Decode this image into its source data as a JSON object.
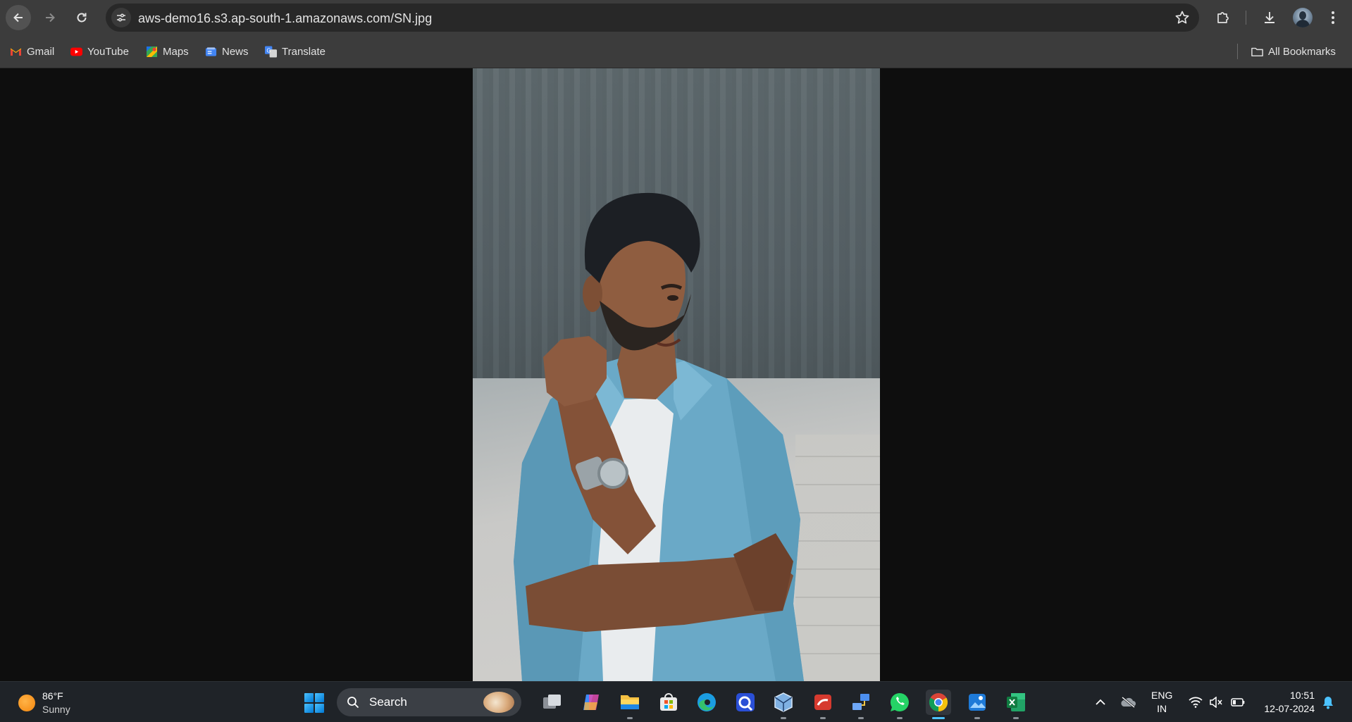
{
  "browser": {
    "url": "aws-demo16.s3.ap-south-1.amazonaws.com/SN.jpg",
    "bookmarks": [
      {
        "label": "Gmail",
        "icon": "gmail-icon"
      },
      {
        "label": "YouTube",
        "icon": "youtube-icon"
      },
      {
        "label": "Maps",
        "icon": "maps-icon"
      },
      {
        "label": "News",
        "icon": "news-icon"
      },
      {
        "label": "Translate",
        "icon": "translate-icon"
      }
    ],
    "all_bookmarks_label": "All Bookmarks"
  },
  "taskbar": {
    "weather": {
      "temp": "86°F",
      "condition": "Sunny"
    },
    "search_label": "Search",
    "apps": [
      "task-view",
      "copilot",
      "file-explorer",
      "microsoft-store",
      "edge",
      "app-c",
      "virtualbox",
      "app-red",
      "network-app",
      "whatsapp",
      "chrome",
      "photos",
      "excel"
    ],
    "language": {
      "line1": "ENG",
      "line2": "IN"
    },
    "clock": {
      "time": "10:51",
      "date": "12-07-2024"
    }
  },
  "colors": {
    "chrome_bar": "#3c3c3c",
    "omnibox": "#282828",
    "page_bg": "#0e0e0e",
    "taskbar_bg": "#1f2328",
    "accent": "#4cc2ff"
  }
}
